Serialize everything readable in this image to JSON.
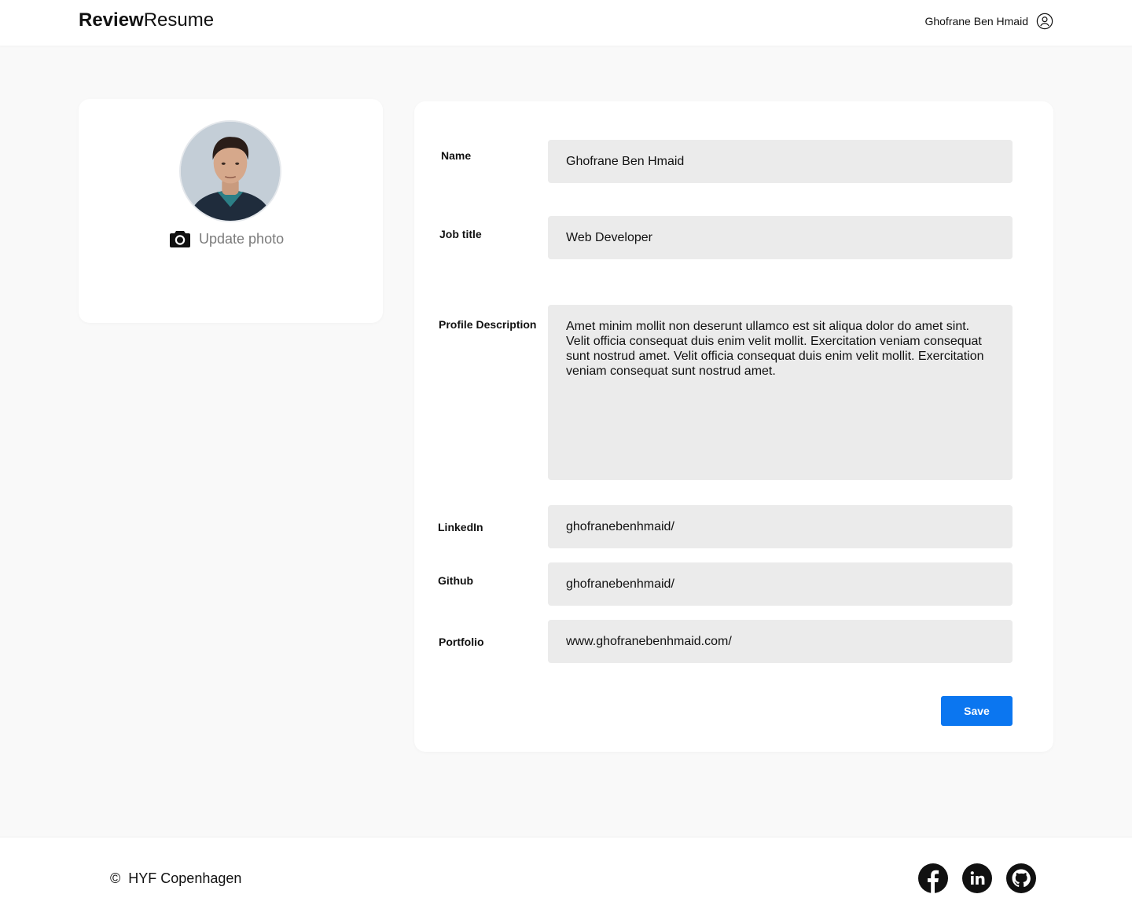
{
  "header": {
    "brand_bold": "Review",
    "brand_light": "Resume",
    "user_name": "Ghofrane Ben Hmaid",
    "user_icon": "user-circle-icon"
  },
  "photo_card": {
    "update_photo_label": "Update photo",
    "camera_icon": "camera-icon"
  },
  "form": {
    "name_label": "Name",
    "name_value": "Ghofrane Ben Hmaid",
    "job_title_label": "Job title",
    "job_title_value": "Web Developer",
    "profile_description_label": "Profile Description",
    "profile_description_value": "Amet minim mollit non deserunt ullamco est sit aliqua dolor do amet sint. Velit officia consequat duis enim velit mollit. Exercitation veniam consequat sunt nostrud amet. Velit officia consequat duis enim velit mollit. Exercitation veniam consequat sunt nostrud amet.",
    "linkedin_label": "LinkedIn",
    "linkedin_value": "ghofranebenhmaid/",
    "github_label": "Github",
    "github_value": "ghofranebenhmaid/",
    "portfolio_label": "Portfolio",
    "portfolio_value": "www.ghofranebenhmaid.com/",
    "save_label": "Save"
  },
  "footer": {
    "copyright_symbol": "©",
    "copyright_text": "HYF Copenhagen",
    "social_icons": [
      "facebook-icon",
      "linkedin-icon",
      "github-icon"
    ]
  },
  "colors": {
    "page_background": "#f9f9f9",
    "card_background": "#ffffff",
    "field_background": "#ebebeb",
    "accent_blue": "#0b76f0",
    "muted_text": "#7b7b7b"
  }
}
